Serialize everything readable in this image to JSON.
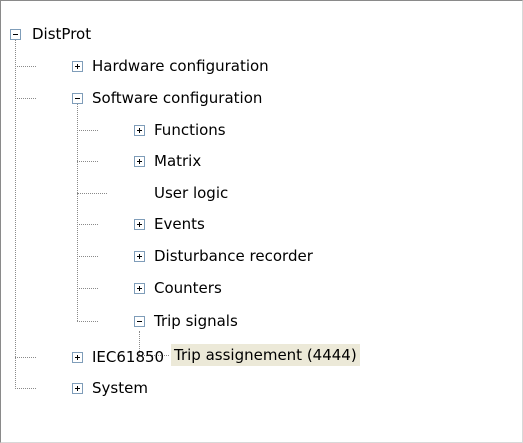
{
  "tree": {
    "root": {
      "label": "DistProt",
      "state": "expanded"
    },
    "items": [
      {
        "label": "Hardware configuration",
        "state": "collapsed"
      },
      {
        "label": "Software configuration",
        "state": "expanded",
        "children": [
          {
            "label": "Functions",
            "state": "collapsed"
          },
          {
            "label": "Matrix",
            "state": "collapsed"
          },
          {
            "label": "User logic",
            "state": "leaf"
          },
          {
            "label": "Events",
            "state": "collapsed"
          },
          {
            "label": "Disturbance recorder",
            "state": "collapsed"
          },
          {
            "label": "Counters",
            "state": "collapsed"
          },
          {
            "label": "Trip signals",
            "state": "expanded",
            "children": [
              {
                "label": "Trip assignement (4444)",
                "state": "selected"
              }
            ]
          }
        ]
      },
      {
        "label": "IEC61850",
        "state": "collapsed"
      },
      {
        "label": "System",
        "state": "collapsed"
      }
    ]
  }
}
